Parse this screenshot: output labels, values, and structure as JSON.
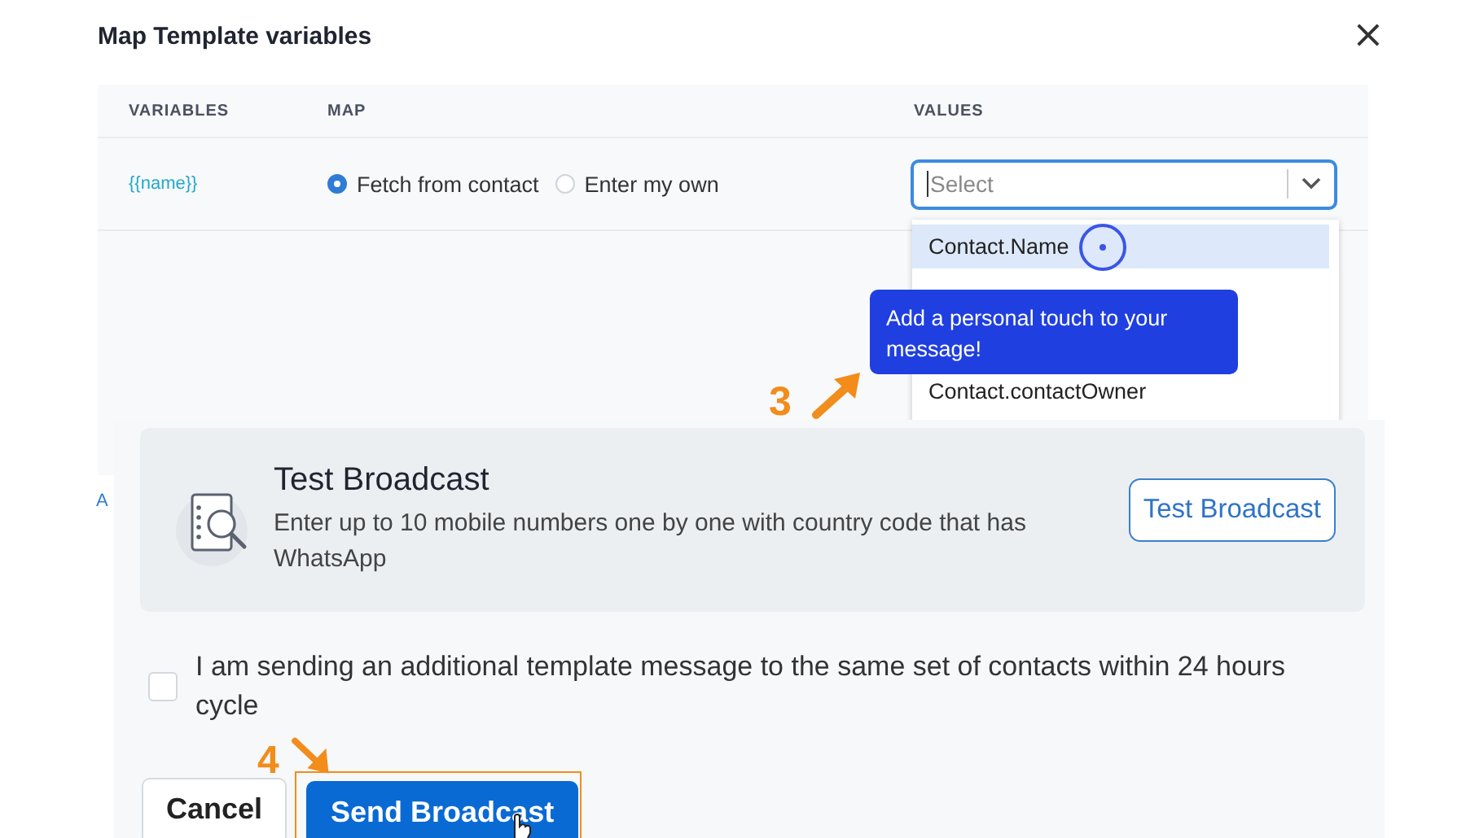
{
  "dialog": {
    "title": "Map Template variables",
    "close": "×"
  },
  "table": {
    "columns": [
      "VARIABLES",
      "MAP",
      "VALUES"
    ],
    "rows": [
      {
        "variable": "{{name}}",
        "map_options": [
          {
            "label": "Fetch from contact",
            "selected": true
          },
          {
            "label": "Enter my own",
            "selected": false
          }
        ],
        "value_placeholder": "Select"
      }
    ]
  },
  "dropdown": {
    "options": [
      {
        "label": "Contact.Name",
        "highlighted": true
      },
      {
        "label": "Contact.contactOwner",
        "highlighted": false
      }
    ]
  },
  "tooltip": {
    "text": "Add a personal touch to your message!"
  },
  "steps": [
    "3",
    "4"
  ],
  "partial_link": "A",
  "test_broadcast": {
    "title": "Test Broadcast",
    "description": "Enter up to 10 mobile numbers one by one with country code that has WhatsApp",
    "button": "Test Broadcast"
  },
  "consent": {
    "label": "I am sending an additional template message to the same set of contacts within 24 hours cycle",
    "checked": false
  },
  "buttons": [
    {
      "label": "Cancel",
      "kind": "secondary"
    },
    {
      "label": "Send Broadcast",
      "kind": "primary",
      "highlighted": true
    }
  ]
}
